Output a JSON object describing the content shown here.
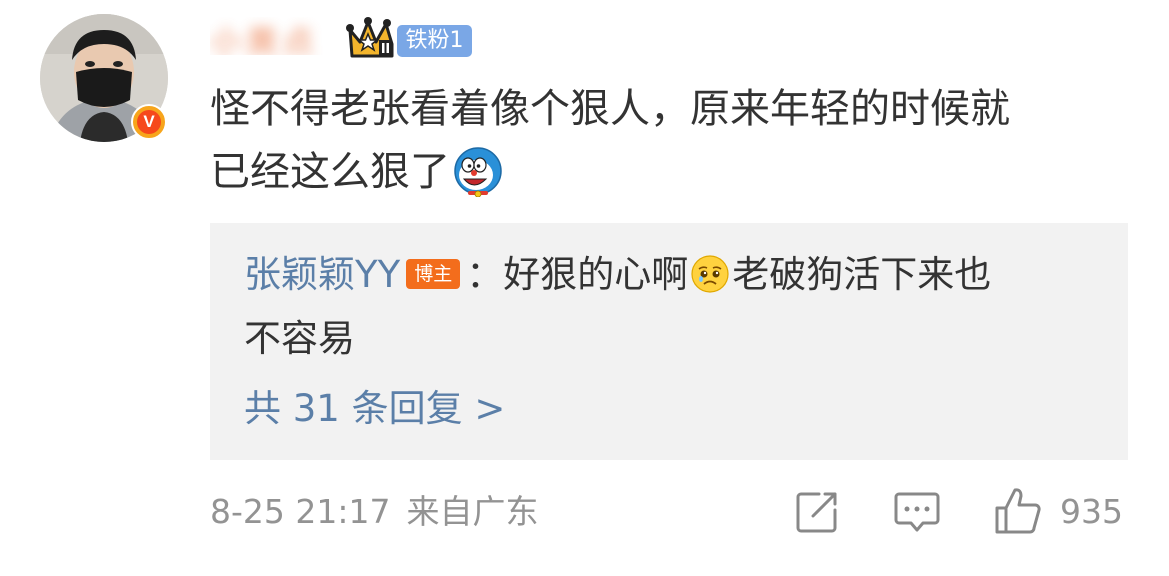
{
  "comment": {
    "username": "小黄点",
    "fan_badge": "铁粉1",
    "text_line1": "怪不得老张看着像个狠人，原来年轻的时候就",
    "text_line2": "已经这么狠了",
    "emoji": "doraemon-emoji"
  },
  "reply": {
    "author": "张颖颖YY",
    "author_badge": "博主",
    "text_line1_before": "：好狠的心啊",
    "emoji": "sad-face-emoji",
    "text_line1_after": "老破狗活下来也",
    "text_line2": "不容易",
    "more_link": "共 31 条回复 >"
  },
  "meta": {
    "time": "8-25 21:17",
    "source": "来自广东",
    "like_count": "935"
  },
  "icons": [
    "verified-v-icon",
    "crown-level-icon",
    "share-icon",
    "comment-icon",
    "like-icon"
  ],
  "colors": {
    "link": "#5b7fa8",
    "fan_badge": "#7aa7e6",
    "blogger_badge": "#f36d1c",
    "verified_badge": "#f6481b",
    "meta_text": "#939393",
    "body_text": "#333333",
    "reply_bg": "#f2f2f2"
  }
}
